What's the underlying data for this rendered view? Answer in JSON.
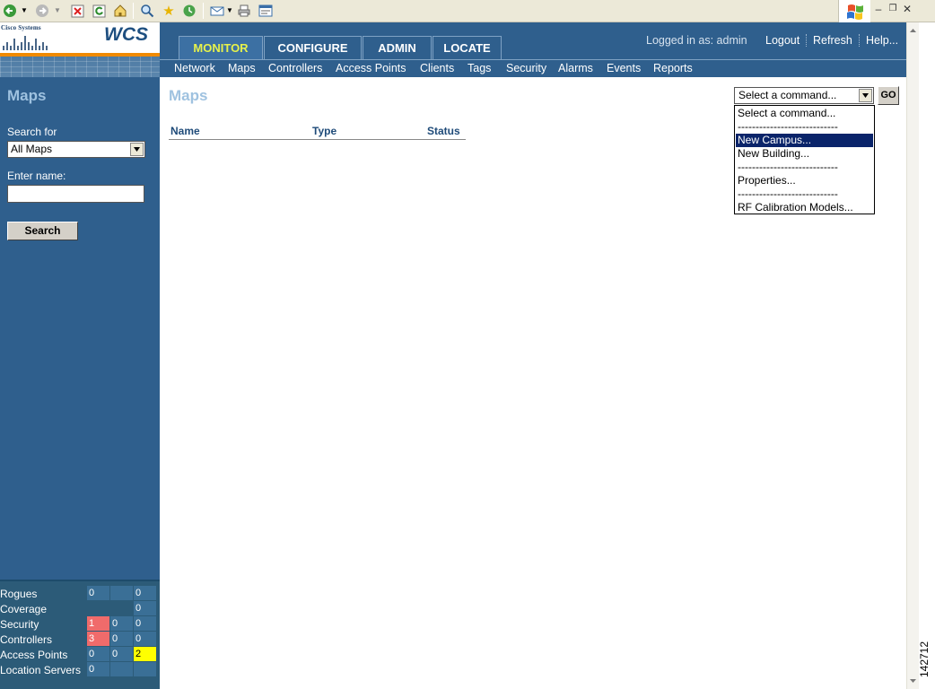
{
  "logo": {
    "company": "Cisco Systems",
    "product": "WCS"
  },
  "tabs": [
    {
      "label": "MONITOR",
      "active": true
    },
    {
      "label": "CONFIGURE",
      "active": false
    },
    {
      "label": "ADMIN",
      "active": false
    },
    {
      "label": "LOCATE",
      "active": false
    }
  ],
  "header": {
    "logged_in_prefix": "Logged in as:",
    "user": "admin",
    "links": [
      "Logout",
      "Refresh",
      "Help..."
    ]
  },
  "subnav": [
    "Network",
    "Maps",
    "Controllers",
    "Access Points",
    "Clients",
    "Tags",
    "Security",
    "Alarms",
    "Events",
    "Reports"
  ],
  "sidebar": {
    "title": "Maps",
    "search_for_label": "Search for",
    "search_for_value": "All Maps",
    "enter_name_label": "Enter name:",
    "name_value": "",
    "search_button": "Search"
  },
  "main": {
    "title": "Maps",
    "columns": [
      "Name",
      "Type",
      "Status"
    ],
    "command_select_value": "Select a command...",
    "go_button": "GO",
    "command_options": [
      {
        "label": "Select a command...",
        "selected": false
      },
      {
        "label": "----------------------------",
        "selected": false
      },
      {
        "label": "New Campus...",
        "selected": true
      },
      {
        "label": "New Building...",
        "selected": false
      },
      {
        "label": "----------------------------",
        "selected": false
      },
      {
        "label": "Properties...",
        "selected": false
      },
      {
        "label": "----------------------------",
        "selected": false
      },
      {
        "label": "RF Calibration Models...",
        "selected": false
      }
    ]
  },
  "alarm_summary": [
    {
      "label": "Rogues",
      "critical": "0",
      "major": "",
      "minor": "0"
    },
    {
      "label": "Coverage",
      "critical": "",
      "major": "",
      "minor": "0"
    },
    {
      "label": "Security",
      "critical": "1",
      "major": "0",
      "minor": "0"
    },
    {
      "label": "Controllers",
      "critical": "3",
      "major": "0",
      "minor": "0"
    },
    {
      "label": "Access Points",
      "critical": "0",
      "major": "0",
      "minor": "2"
    },
    {
      "label": "Location Servers",
      "critical": "0",
      "major": "",
      "minor": ""
    }
  ],
  "figure_number": "142712",
  "colors": {
    "header_bg": "#2f5f8d",
    "active_tab_text": "#e7f24b",
    "critical": "#f06b6b",
    "minor": "#ffff00",
    "selected_option": "#0a246a"
  }
}
